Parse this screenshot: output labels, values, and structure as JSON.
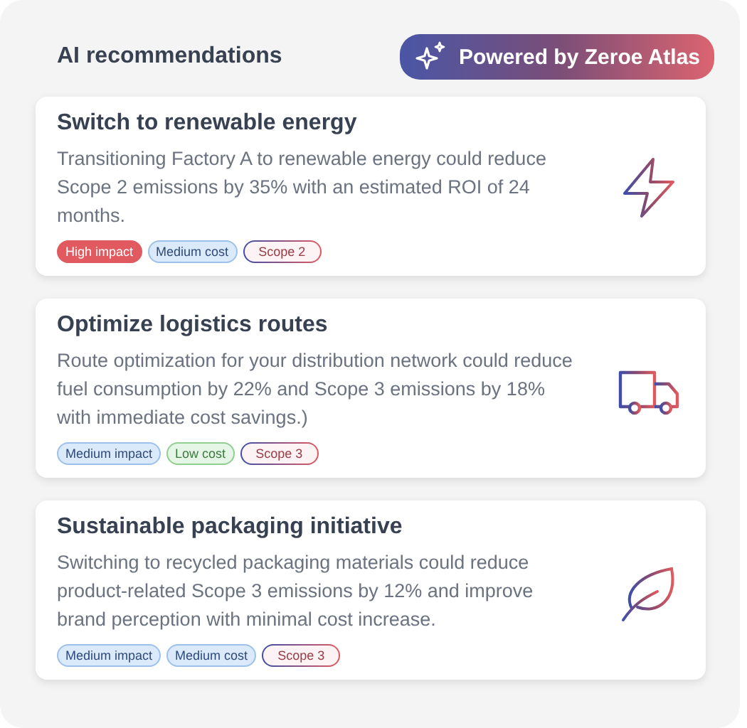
{
  "header": {
    "title": "AI recommendations",
    "badge": "Powered by Zeroe Atlas"
  },
  "cards": [
    {
      "title": "Switch to renewable energy",
      "text": "Transitioning Factory A to renewable energy could reduce Scope 2 emissions by 35% with an estimated ROI of 24 months.",
      "tags": [
        {
          "label": "High impact",
          "kind": "high"
        },
        {
          "label": "Medium cost",
          "kind": "medium"
        },
        {
          "label": "Scope 2",
          "kind": "scope"
        }
      ]
    },
    {
      "title": "Optimize logistics routes",
      "text": "Route optimization for your distribution network could reduce fuel consumption by 22% and Scope 3 emissions by 18% with immediate cost savings.)",
      "tags": [
        {
          "label": "Medium impact",
          "kind": "medium"
        },
        {
          "label": "Low cost",
          "kind": "low"
        },
        {
          "label": "Scope 3",
          "kind": "scope"
        }
      ]
    },
    {
      "title": "Sustainable packaging initiative",
      "text": "Switching to recycled packaging materials could reduce product-related Scope 3 emissions by 12% and improve brand perception with minimal cost increase.",
      "tags": [
        {
          "label": "Medium impact",
          "kind": "medium"
        },
        {
          "label": "Medium cost",
          "kind": "medium"
        },
        {
          "label": "Scope 3",
          "kind": "scope"
        }
      ]
    }
  ]
}
